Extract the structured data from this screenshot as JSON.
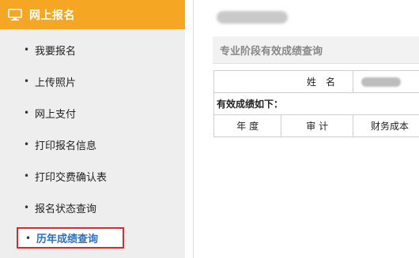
{
  "sidebar": {
    "header_title": "网上报名",
    "items": [
      {
        "label": "我要报名"
      },
      {
        "label": "上传照片"
      },
      {
        "label": "网上支付"
      },
      {
        "label": "打印报名信息"
      },
      {
        "label": "打印交费确认表"
      },
      {
        "label": "报名状态查询"
      },
      {
        "label": "历年成绩查询"
      }
    ],
    "bullet": "•",
    "active_index": 6
  },
  "main": {
    "section_title": "专业阶段有效成绩查询",
    "table": {
      "name_label": "姓名",
      "valid_scores_label": "有效成绩如下：",
      "columns": [
        "年 度",
        "审 计",
        "财务成本"
      ]
    }
  },
  "colors": {
    "header_orange": "#f5a623",
    "sidebar_bg": "#eeeeee",
    "active_border": "#e0282a",
    "active_text": "#2f6fbf"
  }
}
